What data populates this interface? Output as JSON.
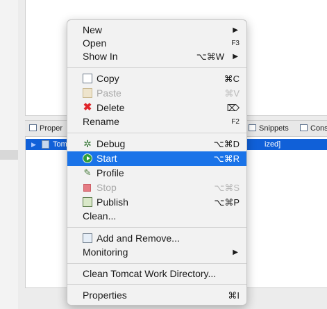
{
  "background_view": {
    "tabs": [
      {
        "label": "Proper"
      },
      {
        "label": "Snippets"
      },
      {
        "label": "Cons"
      }
    ],
    "selected_row": {
      "expander": "▶",
      "name": "Tom",
      "status_suffix": "ized]"
    }
  },
  "context_menu": {
    "items": [
      {
        "label": "New",
        "submenu": "▶"
      },
      {
        "label": "Open",
        "shortcut": "F3"
      },
      {
        "label": "Show In",
        "shortcut": "⌥⌘W",
        "submenu": "▶"
      },
      {
        "label": "Copy",
        "shortcut": "⌘C",
        "icon": "copy-icon"
      },
      {
        "label": "Paste",
        "shortcut": "⌘V",
        "icon": "paste-icon",
        "disabled": true
      },
      {
        "label": "Delete",
        "shortcut": "⌦",
        "icon": "delete-icon"
      },
      {
        "label": "Rename",
        "shortcut": "F2"
      },
      {
        "label": "Debug",
        "shortcut": "⌥⌘D",
        "icon": "debug-icon"
      },
      {
        "label": "Start",
        "shortcut": "⌥⌘R",
        "icon": "start-icon",
        "highlighted": true
      },
      {
        "label": "Profile",
        "icon": "profile-icon"
      },
      {
        "label": "Stop",
        "shortcut": "⌥⌘S",
        "icon": "stop-icon",
        "disabled": true
      },
      {
        "label": "Publish",
        "shortcut": "⌥⌘P",
        "icon": "publish-icon"
      },
      {
        "label": "Clean..."
      },
      {
        "label": "Add and Remove...",
        "icon": "add-remove-icon"
      },
      {
        "label": "Monitoring",
        "submenu": "▶"
      },
      {
        "label": "Clean Tomcat Work Directory..."
      },
      {
        "label": "Properties",
        "shortcut": "⌘I"
      }
    ]
  },
  "colors": {
    "highlight": "#1a73e8",
    "selection_row": "#1060d8",
    "delete_icon": "#e0252a",
    "start_icon": "#2e9d3a"
  }
}
